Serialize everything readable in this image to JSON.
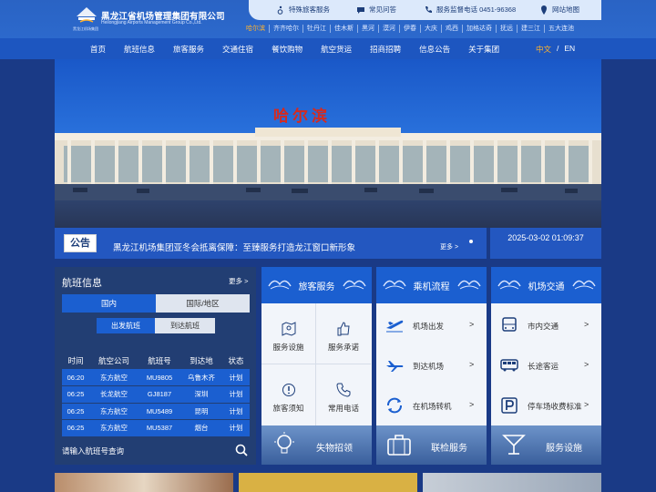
{
  "header": {
    "org_name_cn": "黑龙江省机场管理集团有限公司",
    "org_name_en": "Heilongjiang Airports Management Group Co.,Ltd.",
    "logo_sub": "黑龙江机场集团",
    "utility_links": [
      {
        "label": "特殊旅客服务",
        "icon": "wheelchair-icon"
      },
      {
        "label": "常见问答",
        "icon": "chat-bubble-icon"
      },
      {
        "label": "服务监督电话 0451-96368",
        "icon": "phone-icon"
      },
      {
        "label": "网站地图",
        "icon": "map-pin-icon"
      }
    ],
    "cities": [
      "哈尔滨",
      "齐齐哈尔",
      "牡丹江",
      "佳木斯",
      "黑河",
      "漠河",
      "伊春",
      "大庆",
      "鸡西",
      "加格达奇",
      "抚远",
      "建三江",
      "五大连池"
    ],
    "active_city": "哈尔滨"
  },
  "nav": {
    "items": [
      "首页",
      "航班信息",
      "旅客服务",
      "交通住宿",
      "餐饮购物",
      "航空货运",
      "招商招聘",
      "信息公告",
      "关于集团"
    ],
    "lang_cn": "中文",
    "lang_sep": "/",
    "lang_en": "EN"
  },
  "banner": {
    "title": "哈尔滨"
  },
  "notice": {
    "badge": "公告",
    "text": "黑龙江机场集团亚冬会抵离保障：至臻服务打造龙江窗口新形象",
    "more": "更多 >",
    "datetime": "2025-03-02 01:09:37"
  },
  "flight": {
    "title": "航班信息",
    "more": "更多 >",
    "tab_domestic": "国内",
    "tab_international": "国际/地区",
    "tab_departure": "出发航班",
    "tab_arrival": "到达航班",
    "columns": [
      "时间",
      "航空公司",
      "航班号",
      "到达地",
      "状态"
    ],
    "rows": [
      [
        "06:20",
        "东方航空",
        "MU9805",
        "乌鲁木齐",
        "计划"
      ],
      [
        "06:25",
        "长龙航空",
        "GJ8187",
        "深圳",
        "计划"
      ],
      [
        "06:25",
        "东方航空",
        "MU5489",
        "昆明",
        "计划"
      ],
      [
        "06:25",
        "东方航空",
        "MU5387",
        "烟台",
        "计划"
      ]
    ],
    "search_placeholder": "请输入航班号查询"
  },
  "cards": {
    "passenger": {
      "title": "旅客服务",
      "items": [
        {
          "label": "服务设施",
          "icon": "map-icon"
        },
        {
          "label": "服务承诺",
          "icon": "thumbs-up-icon"
        },
        {
          "label": "旅客须知",
          "icon": "notice-icon"
        },
        {
          "label": "常用电话",
          "icon": "phone-icon"
        }
      ],
      "footer": "失物招领"
    },
    "process": {
      "title": "乘机流程",
      "items": [
        {
          "label": "机场出发",
          "icon": "plane-takeoff-icon"
        },
        {
          "label": "到达机场",
          "icon": "plane-landing-icon"
        },
        {
          "label": "在机场转机",
          "icon": "transfer-icon"
        }
      ],
      "arrow": ">",
      "footer": "联检服务"
    },
    "traffic": {
      "title": "机场交通",
      "items": [
        {
          "label": "市内交通",
          "icon": "bus-icon"
        },
        {
          "label": "长途客运",
          "icon": "coach-icon"
        },
        {
          "label": "停车场收费标准",
          "icon": "parking-icon"
        }
      ],
      "arrow": ">",
      "footer": "服务设施"
    }
  }
}
